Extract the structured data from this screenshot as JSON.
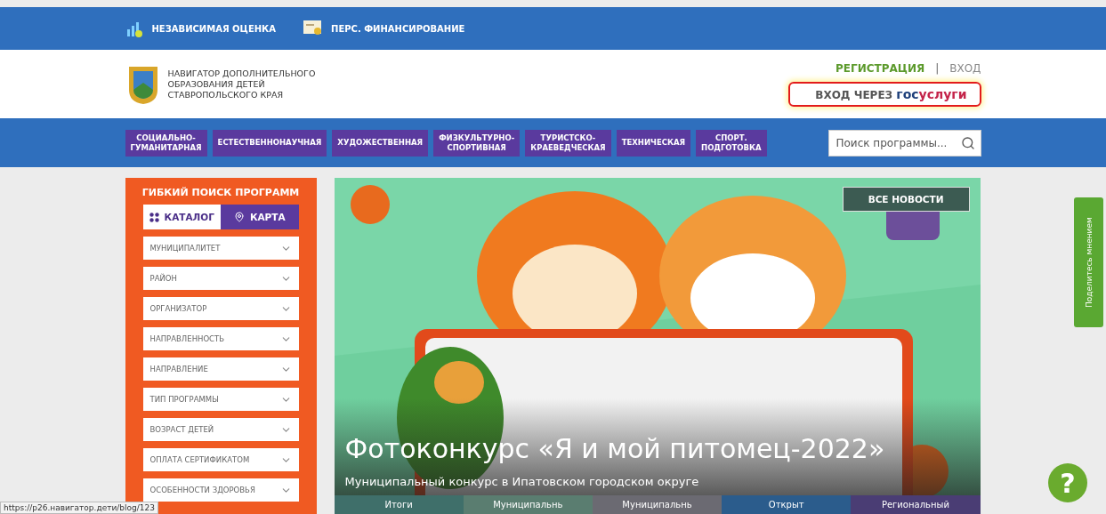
{
  "top_bar": {
    "links": [
      {
        "label": "НЕЗАВИСИМАЯ ОЦЕНКА",
        "kind": "chart"
      },
      {
        "label": "ПЕРС. ФИНАНСИРОВАНИЕ",
        "kind": "certificate"
      }
    ]
  },
  "header": {
    "logo_text": "НАВИГАТОР ДОПОЛНИТЕЛЬНОГО\nОБРАЗОВАНИЯ ДЕТЕЙ\nСТАВРОПОЛЬСКОГО КРАЯ",
    "register": "РЕГИСТРАЦИЯ",
    "separator": "|",
    "login": "ВХОД",
    "gosuslugi": {
      "prefix": "ВХОД ЧЕРЕЗ",
      "brand_dark": "гос",
      "brand_red": "услуги"
    }
  },
  "nav": {
    "categories": [
      "СОЦИАЛЬНО-\nГУМАНИТАРНАЯ",
      "ЕСТЕСТВЕННОНАУЧНАЯ",
      "ХУДОЖЕСТВЕННАЯ",
      "ФИЗКУЛЬТУРНО-\nСПОРТИВНАЯ",
      "ТУРИСТСКО-\nКРАЕВЕДЧЕСКАЯ",
      "ТЕХНИЧЕСКАЯ",
      "СПОРТ.\nПОДГОТОВКА"
    ],
    "search": {
      "placeholder": "Поиск программы..."
    }
  },
  "sidebar": {
    "title": "ГИБКИЙ ПОИСК ПРОГРАММ",
    "tabs": [
      {
        "label": "КАТАЛОГ",
        "kind": "grid",
        "selected": true
      },
      {
        "label": "КАРТА",
        "kind": "pin",
        "selected": false
      }
    ],
    "filters": [
      "МУНИЦИПАЛИТЕТ",
      "РАЙОН",
      "ОРГАНИЗАТОР",
      "НАПРАВЛЕННОСТЬ",
      "НАПРАВЛЕНИЕ",
      "ТИП ПРОГРАММЫ",
      "ВОЗРАСТ ДЕТЕЙ",
      "ОПЛАТА СЕРТИФИКАТОМ",
      "ОСОБЕННОСТИ ЗДОРОВЬЯ"
    ]
  },
  "banner": {
    "kind": "picture",
    "all_news": "ВСЕ НОВОСТИ",
    "title": "Фотоконкурс «Я и мой питомец-2022»",
    "subtitle": "Муниципальный конкурс в Ипатовском городском округе",
    "thumbnails": [
      {
        "label": "Итоги",
        "color": "#3f6f6a"
      },
      {
        "label": "Муниципальнь",
        "color": "#5a7d70"
      },
      {
        "label": "Муниципальнь",
        "color": "#6b6a72"
      },
      {
        "label": "Открыт",
        "color": "#2b5c8c"
      },
      {
        "label": "Региональный",
        "color": "#4a3d74"
      }
    ]
  },
  "feedback_tab": "Поделитесь мнением",
  "help_button": "?",
  "status_url": "https://p26.навигатор.дети/blog/123"
}
